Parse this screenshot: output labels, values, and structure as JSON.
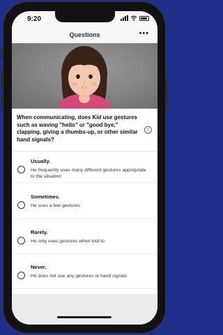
{
  "status_bar": {
    "time": "9:20"
  },
  "header": {
    "title": "Questions",
    "more_label": "•••"
  },
  "question": {
    "text": "When communicating, does Kid use gestures such as waving \"hello\" or \"good bye,\" clapping, giving a thumbs-up, or other similar hand signals?",
    "info_icon": "i"
  },
  "options": [
    {
      "title": "Usually.",
      "description": "He frequently uses many different gestures appropriate to the situation"
    },
    {
      "title": "Sometimes.",
      "description": "He uses a few gestures"
    },
    {
      "title": "Rarely.",
      "description": "He only uses gestures when told to"
    },
    {
      "title": "Never.",
      "description": "He does not use any gestures or hand signals"
    }
  ],
  "icons": [
    "cellular-signal-icon",
    "wifi-icon",
    "battery-icon",
    "more-icon",
    "info-icon",
    "radio-icon"
  ],
  "colors": {
    "background": "#1f2f8a",
    "nav_title": "#1f2d6e",
    "info_accent": "#2f63d6"
  }
}
